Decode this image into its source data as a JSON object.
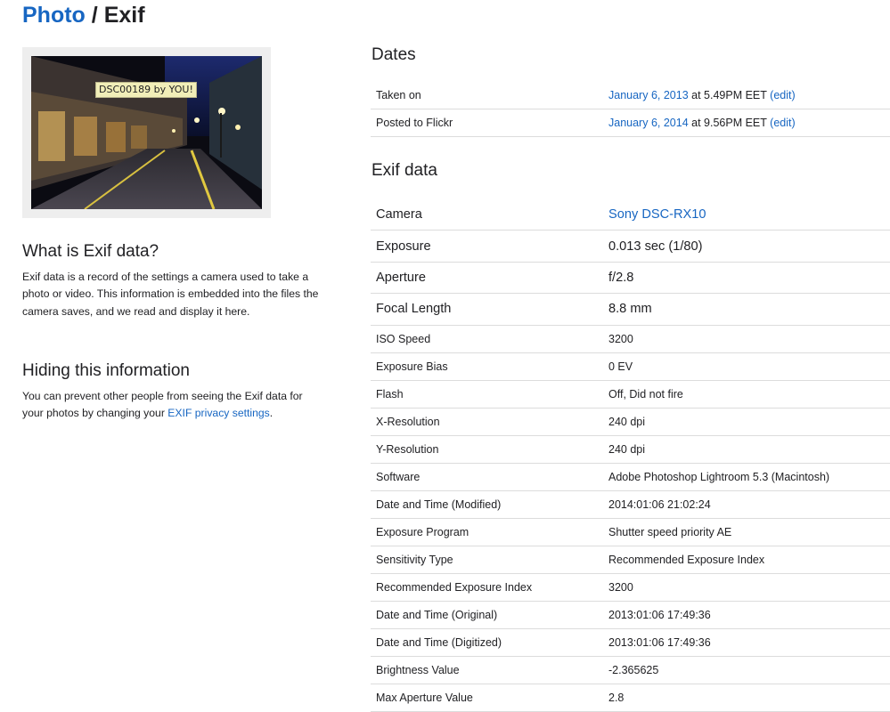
{
  "header": {
    "crumb": "Photo",
    "separator": "/",
    "title": "Exif"
  },
  "photo": {
    "tag_text": "DSC00189 by YOU!"
  },
  "sidebar": {
    "what_title": "What is Exif data?",
    "what_text": "Exif data is a record of the settings a camera used to take a photo or video. This information is embedded into the files the camera saves, and we read and display it here.",
    "hide_title": "Hiding this information",
    "hide_text_before": "You can prevent other people from seeing the Exif data for your photos by changing your ",
    "hide_link": "EXIF privacy settings",
    "hide_text_after": "."
  },
  "dates": {
    "title": "Dates",
    "rows": [
      {
        "label": "Taken on",
        "date": "January 6, 2013",
        "time": " at 5.49PM EET ",
        "edit_open": "(",
        "edit": "edit",
        "edit_close": ")"
      },
      {
        "label": "Posted to Flickr",
        "date": "January 6, 2014",
        "time": " at 9.56PM EET ",
        "edit_open": "(",
        "edit": "edit",
        "edit_close": ")"
      }
    ]
  },
  "exif": {
    "title": "Exif data",
    "camera": {
      "label": "Camera",
      "value": "Sony DSC-RX10"
    },
    "rows": [
      {
        "label": "Exposure",
        "value": "0.013 sec (1/80)"
      },
      {
        "label": "Aperture",
        "value": "f/2.8"
      },
      {
        "label": "Focal Length",
        "value": "8.8 mm"
      },
      {
        "label": "ISO Speed",
        "value": "3200"
      },
      {
        "label": "Exposure Bias",
        "value": "0 EV"
      },
      {
        "label": "Flash",
        "value": "Off, Did not fire"
      },
      {
        "label": "X-Resolution",
        "value": "240 dpi"
      },
      {
        "label": "Y-Resolution",
        "value": "240 dpi"
      },
      {
        "label": "Software",
        "value": "Adobe Photoshop Lightroom 5.3 (Macintosh)"
      },
      {
        "label": "Date and Time (Modified)",
        "value": "2014:01:06 21:02:24"
      },
      {
        "label": "Exposure Program",
        "value": "Shutter speed priority AE"
      },
      {
        "label": "Sensitivity Type",
        "value": "Recommended Exposure Index"
      },
      {
        "label": "Recommended Exposure Index",
        "value": "3200"
      },
      {
        "label": "Date and Time (Original)",
        "value": "2013:01:06 17:49:36"
      },
      {
        "label": "Date and Time (Digitized)",
        "value": "2013:01:06 17:49:36"
      },
      {
        "label": "Brightness Value",
        "value": "-2.365625"
      },
      {
        "label": "Max Aperture Value",
        "value": "2.8"
      }
    ]
  },
  "colors": {
    "link": "#1766c2",
    "text": "#212124",
    "divider": "#dcdcdc"
  }
}
